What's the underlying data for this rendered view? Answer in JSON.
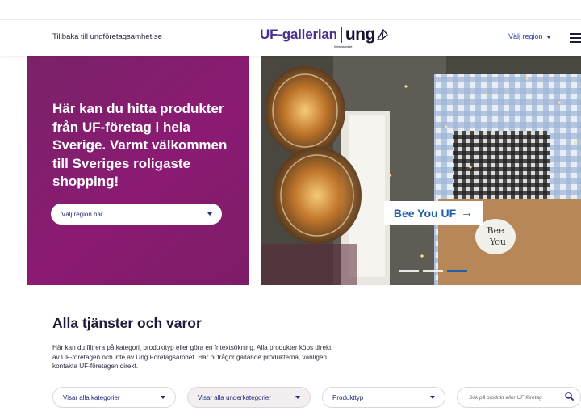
{
  "header": {
    "back_link": "Tillbaka till ungföretagsamhet.se",
    "logo_brand": "UF-gallerian",
    "logo_ung": "ung",
    "logo_sub": "företagsamhet",
    "region_select": "Välj region",
    "menu_icon": "hamburger-menu-icon"
  },
  "hero": {
    "text": "Här kan du hitta produkter från UF-företag i hela Sverige. Varmt välkommen till Sveriges roligaste shopping!",
    "region_placeholder": "Välj region här",
    "company_name": "Bee You UF",
    "company_arrow": "→",
    "label_text": "Bee You",
    "slide_count": 3,
    "active_slide": 3
  },
  "section": {
    "title": "Alla tjänster och varor",
    "description": "Här kan du filtrera på kategori, produkttyp eller göra en fritextsökning. Alla produkter köps direkt av UF-företagen och inte av Ung Företagsamhet. Har ni frågor gällande produkterna, vänligen kontakta UF-företagen direkt."
  },
  "filters": {
    "category": "Visar alla kategorier",
    "subcategory": "Visar alla underkategorier",
    "product_type": "Produkttyp",
    "search_placeholder": "Sök på produkt eller UF-företag"
  },
  "colors": {
    "brand_purple": "#4a2e8f",
    "hero_magenta": "#8b1a73",
    "accent_blue": "#1f5fa6",
    "navy_text": "#1f2a78"
  }
}
